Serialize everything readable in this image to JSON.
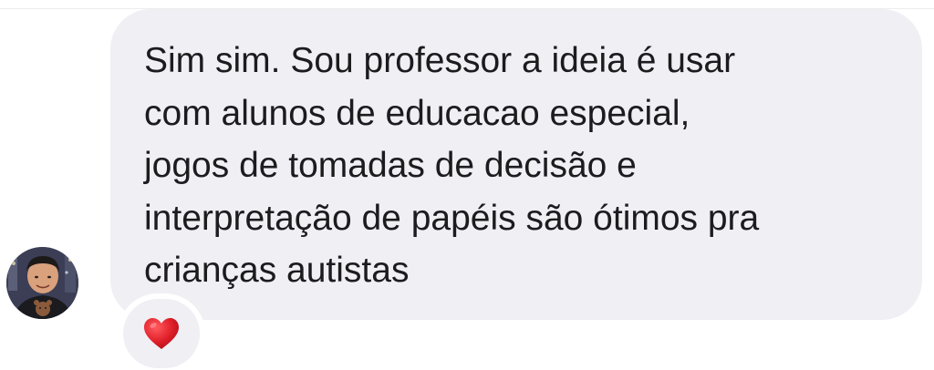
{
  "message": {
    "text": "Sim sim. Sou professor a ideia é usar\ncom alunos de educacao especial,\njogos de tomadas de decisão e\ninterpretação de papéis são ótimos pra\ncrianças autistas"
  },
  "reaction": {
    "icon": "red-heart-icon",
    "color": "#e0202a"
  },
  "avatar": {
    "icon": "user-avatar"
  },
  "colors": {
    "bubble": "#efeff4",
    "text": "#1c1c1e",
    "background": "#ffffff"
  }
}
